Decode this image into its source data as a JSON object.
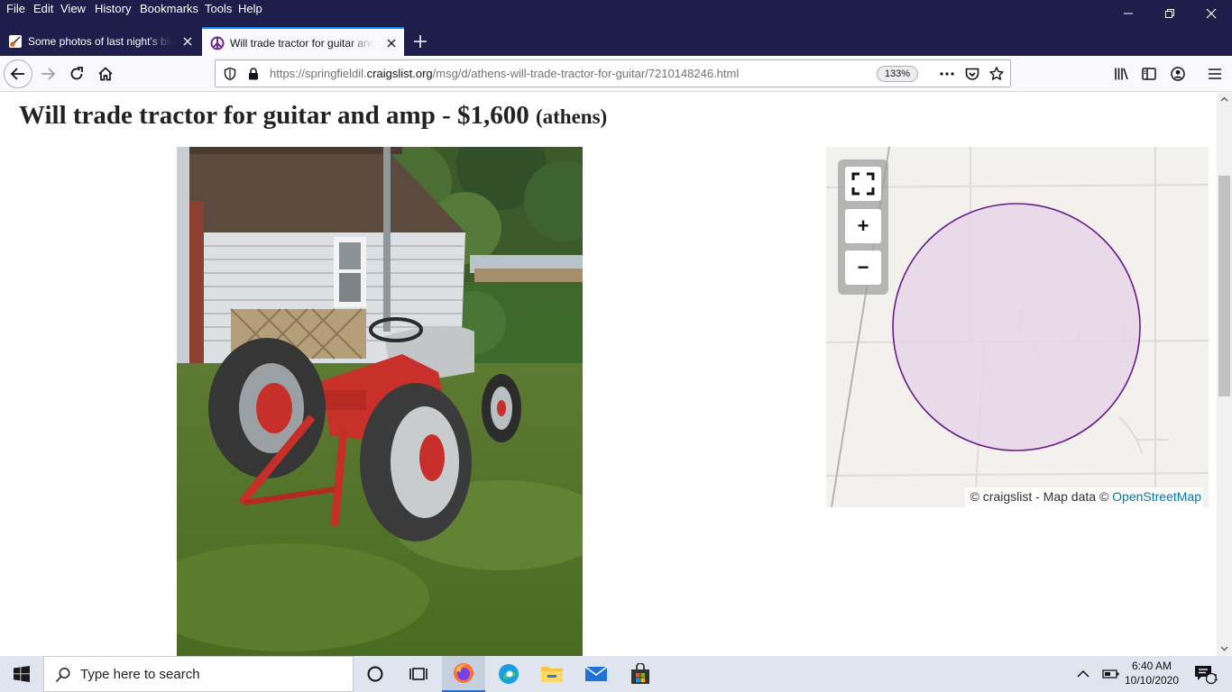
{
  "menu": {
    "items": [
      {
        "label": "File"
      },
      {
        "label": "Edit"
      },
      {
        "label": "View"
      },
      {
        "label": "History"
      },
      {
        "label": "Bookmarks"
      },
      {
        "label": "Tools"
      },
      {
        "label": "Help"
      }
    ]
  },
  "tabs": [
    {
      "title": "Some photos of last night's bike",
      "active": false
    },
    {
      "title": "Will trade tractor for guitar and amp",
      "active": true
    }
  ],
  "navbar": {
    "url_prefix": "https://springfieldil.",
    "url_domain": "craigslist.org",
    "url_path": "/msg/d/athens-will-trade-tractor-for-guitar/7210148246.html",
    "zoom": "133%"
  },
  "posting": {
    "title": "Will trade tractor for guitar and amp - $1,600",
    "location": "(athens)"
  },
  "map": {
    "attribution_prefix": "© craigslist - Map data © ",
    "attribution_link": "OpenStreetMap",
    "zoom_in": "+",
    "zoom_out": "−"
  },
  "taskbar": {
    "search_placeholder": "Type here to search",
    "time": "6:40 AM",
    "date": "10/10/2020",
    "notification_count": "1"
  },
  "colors": {
    "titlebar": "#1f1d4a",
    "circle_stroke": "#6a1b8a",
    "circle_fill": "#e6d6e8",
    "link": "#0078a8"
  }
}
